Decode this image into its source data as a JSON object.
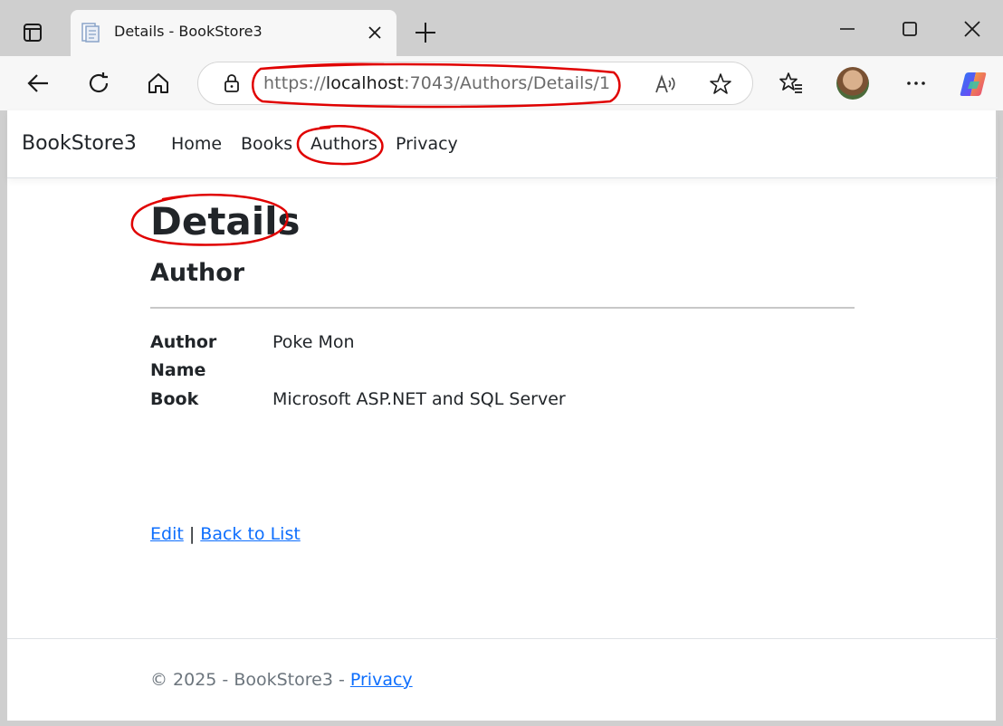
{
  "browser": {
    "tab": {
      "title": "Details - BookStore3"
    },
    "address": {
      "scheme": "https://",
      "host": "localhost",
      "rest": ":7043/Authors/Details/1"
    },
    "icons": [
      "tab-actions-icon",
      "favicon-icon",
      "close-icon",
      "plus-icon",
      "minimize-icon",
      "maximize-icon",
      "window-close-icon",
      "back-arrow-icon",
      "refresh-icon",
      "home-icon",
      "lock-icon",
      "read-aloud-icon",
      "star-icon",
      "favorites-icon",
      "more-icon",
      "copilot-icon"
    ]
  },
  "navbar": {
    "brand": "BookStore3",
    "links": [
      "Home",
      "Books",
      "Authors",
      "Privacy"
    ]
  },
  "main": {
    "title": "Details",
    "subtitle": "Author",
    "fields": [
      {
        "label": "Author Name",
        "value": "Poke Mon"
      },
      {
        "label": "Book",
        "value": "Microsoft ASP.NET and SQL Server"
      }
    ],
    "edit_label": "Edit",
    "separator": "|",
    "back_label": "Back to List"
  },
  "footer": {
    "text": "© 2025 - BookStore3 - ",
    "privacy_label": "Privacy"
  },
  "colors": {
    "annotation": "#e00000",
    "link": "#0d6efd",
    "footer_text": "#6c757d"
  }
}
